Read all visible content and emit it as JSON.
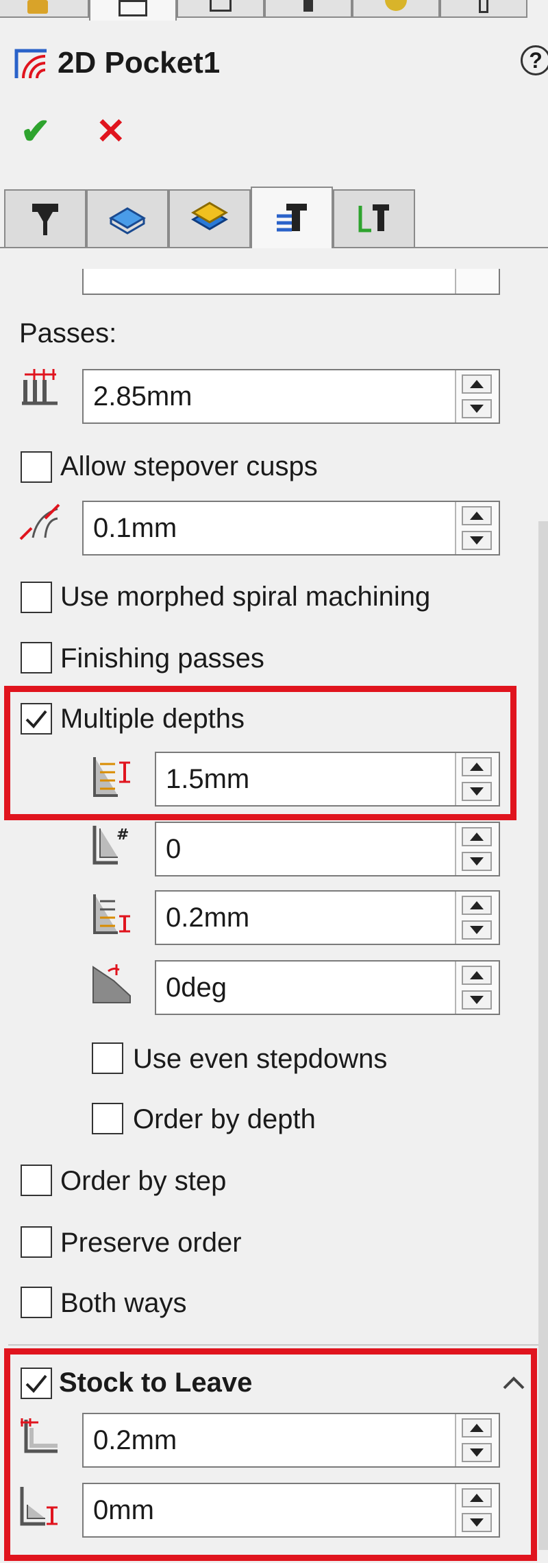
{
  "header": {
    "title": "2D Pocket1",
    "help_glyph": "?"
  },
  "actions": {
    "ok_glyph": "✔",
    "cancel_glyph": "✕"
  },
  "passes": {
    "label": "Passes:",
    "stepover": "2.85mm",
    "allow_stepover_cusps": "Allow stepover cusps",
    "cusp_height": "0.1mm",
    "use_morphed_spiral": "Use morphed spiral machining",
    "finishing_passes": "Finishing passes",
    "multiple_depths": "Multiple depths",
    "max_stepdown": "1.5mm",
    "finish_stepdowns_count": "0",
    "finish_stepdown": "0.2mm",
    "taper_angle": "0deg",
    "use_even_stepdowns": "Use even stepdowns",
    "order_by_depth": "Order by depth",
    "order_by_step": "Order by step",
    "preserve_order": "Preserve order",
    "both_ways": "Both ways"
  },
  "stock_to_leave": {
    "title": "Stock to Leave",
    "radial": "0.2mm",
    "axial": "0mm"
  },
  "checked": {
    "allow_stepover_cusps": false,
    "use_morphed_spiral": false,
    "finishing_passes": false,
    "multiple_depths": true,
    "use_even_stepdowns": false,
    "order_by_depth": false,
    "order_by_step": false,
    "preserve_order": false,
    "both_ways": false,
    "stock_to_leave": true
  },
  "colors": {
    "highlight_red": "#e0141e",
    "ok_green": "#2ea32e",
    "cancel_red": "#e0141e",
    "accent_blue": "#2a62c9"
  }
}
